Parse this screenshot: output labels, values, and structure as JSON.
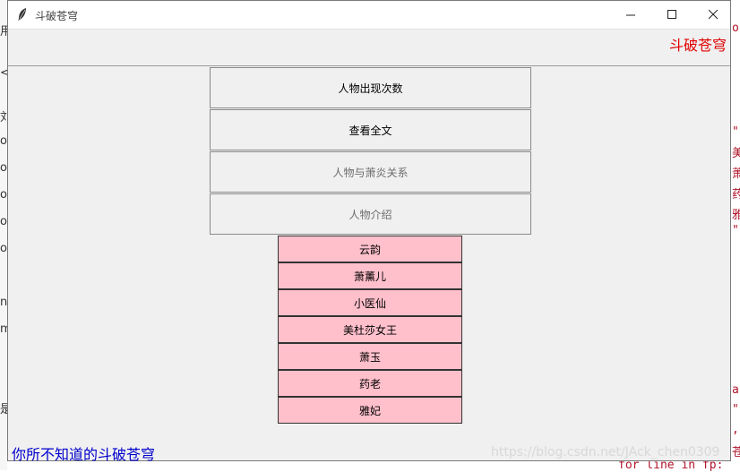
{
  "window": {
    "title": "斗破苍穹"
  },
  "top_label": "斗破苍穹",
  "menu_buttons": [
    {
      "label": "人物出现次数"
    },
    {
      "label": "查看全文"
    },
    {
      "label": "人物与萧炎关系"
    },
    {
      "label": "人物介绍"
    }
  ],
  "characters": [
    "云韵",
    "萧薰儿",
    "小医仙",
    "美杜莎女王",
    "萧玉",
    "药老",
    "雅妃"
  ],
  "bottom_label": "你所不知道的斗破苍穹",
  "watermark": "https://blog.csdn.net/JAck_chen0309",
  "background": {
    "left_fragments": [
      "用",
      "<",
      "刘",
      "or",
      "or",
      "or",
      "or",
      "or",
      "ne",
      "m",
      "是"
    ],
    "right_fragments": [
      "o.",
      "\"",
      "美",
      "萧",
      "药",
      "雅",
      "\"",
      "a",
      "\"",
      ",",
      "苍"
    ],
    "bottom_fragment": "for line in fp:"
  },
  "colors": {
    "top_label": "#e00000",
    "bottom_label": "#0000cc",
    "pink": "#ffc0cb"
  }
}
